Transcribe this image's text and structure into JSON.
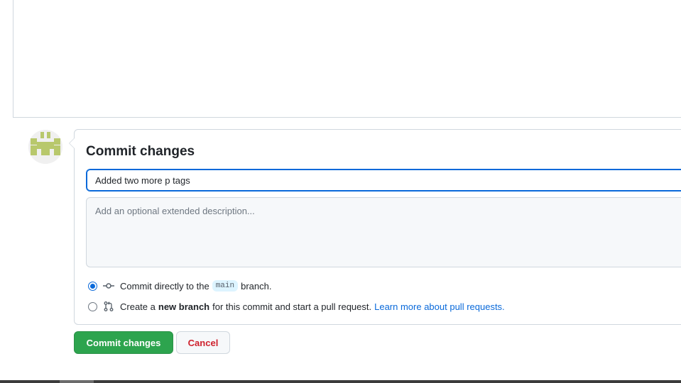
{
  "commit_form": {
    "title": "Commit changes",
    "summary_value": "Added two more p tags",
    "description_placeholder": "Add an optional extended description...",
    "option_direct": {
      "prefix": "Commit directly to the",
      "branch": "main",
      "suffix": "branch.",
      "selected": true,
      "icon": "git-commit-icon"
    },
    "option_new_branch": {
      "prefix": "Create a",
      "bold": "new branch",
      "suffix": "for this commit and start a pull request.",
      "link": "Learn more about pull requests.",
      "selected": false,
      "icon": "git-pull-request-icon"
    }
  },
  "buttons": {
    "commit_label": "Commit changes",
    "cancel_label": "Cancel"
  },
  "colors": {
    "primary_green": "#2da44e",
    "link_blue": "#0969da",
    "danger_red": "#cf222e",
    "avatar_green": "#b8c86c"
  }
}
